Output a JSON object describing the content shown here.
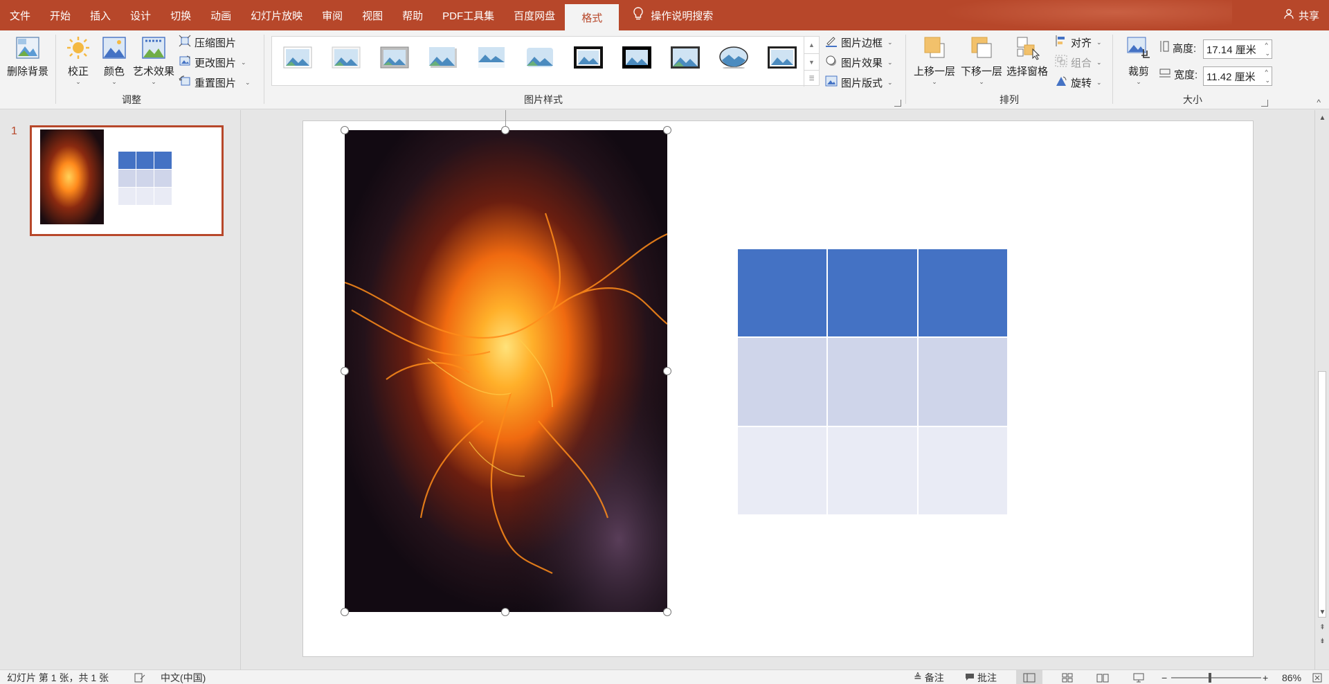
{
  "menu": {
    "tabs": [
      "文件",
      "开始",
      "插入",
      "设计",
      "切换",
      "动画",
      "幻灯片放映",
      "审阅",
      "视图",
      "帮助",
      "PDF工具集",
      "百度网盘",
      "格式"
    ],
    "active_tab": "格式",
    "tell_me": "操作说明搜索",
    "share": "共享"
  },
  "ribbon": {
    "adjust": {
      "label": "调整",
      "remove_bg": "删除背景",
      "corrections": "校正",
      "color": "颜色",
      "artistic": "艺术效果",
      "compress": "压缩图片",
      "change": "更改图片",
      "reset": "重置图片"
    },
    "styles": {
      "label": "图片样式",
      "border": "图片边框",
      "effects": "图片效果",
      "layout": "图片版式"
    },
    "arrange": {
      "label": "排列",
      "bring_forward": "上移一层",
      "send_backward": "下移一层",
      "selection_pane": "选择窗格",
      "align": "对齐",
      "group": "组合",
      "rotate": "旋转"
    },
    "size": {
      "label": "大小",
      "crop": "裁剪",
      "height_label": "高度:",
      "height_value": "17.14 厘米",
      "width_label": "宽度:",
      "width_value": "11.42 厘米"
    }
  },
  "slides_pane": {
    "slide_number": "1"
  },
  "table": {
    "rows": 3,
    "cols": 3,
    "colors": [
      "#4472c4",
      "#cfd5ea",
      "#e9ebf5"
    ]
  },
  "statusbar": {
    "slide_info": "幻灯片 第 1 张，共 1 张",
    "language": "中文(中国)",
    "notes": "备注",
    "comments": "批注",
    "zoom": "86%"
  },
  "colors": {
    "accent": "#b7472a",
    "ribbon_bg": "#f3f3f3"
  }
}
